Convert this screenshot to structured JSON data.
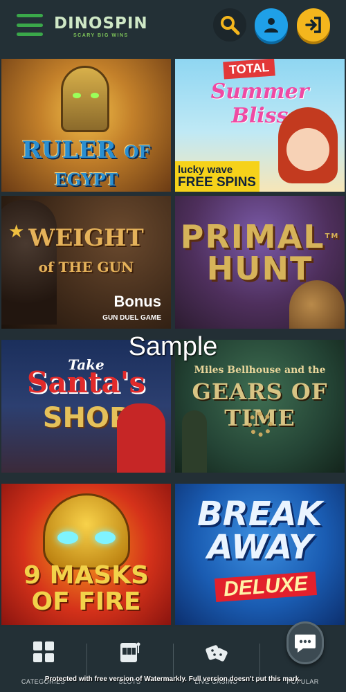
{
  "header": {
    "brand": "DINOSPIN",
    "tagline": "SCARY BIG WINS",
    "icons": [
      "menu-icon",
      "search-icon",
      "user-icon",
      "login-icon"
    ],
    "colors": {
      "accent_green": "#3aa84a",
      "user_blue": "#1fa0e8",
      "login_yellow": "#f4b61d"
    }
  },
  "games": [
    {
      "title_line1": "RULER",
      "title_line2": "OF EGYPT"
    },
    {
      "badge": "TOTAL",
      "title_line1": "Summer",
      "title_line2": "Bliss",
      "promo_line1": "lucky wave",
      "promo_line2": "FREE SPINS"
    },
    {
      "title_line1": "WEIGHT",
      "title_line2": "of THE GUN",
      "bonus": "Bonus",
      "bonus_sub": "GUN DUEL GAME"
    },
    {
      "title_line1": "PRIMAL",
      "title_line2": "HUNT",
      "tm": "TM"
    },
    {
      "title_line0": "Take",
      "title_line1": "Santa's",
      "title_line2": "SHOP"
    },
    {
      "subtitle": "Miles Bellhouse and the",
      "title_line1": "GEARS OF TIME"
    },
    {
      "title_line1": "9 MASKS",
      "title_line2": "OF FIRE"
    },
    {
      "title_line1": "BREAK",
      "title_line2": "AWAY",
      "badge": "DELUXE"
    }
  ],
  "watermark": "Sample",
  "bottom_nav": {
    "items": [
      {
        "label": "CATEGORIES",
        "icon": "grid-icon"
      },
      {
        "label": "SLOTS",
        "icon": "slot-machine-icon"
      },
      {
        "label": "LIVE CASINO",
        "icon": "dice-icon"
      },
      {
        "label": "POPULAR",
        "icon": "star-icon"
      }
    ],
    "chat_icon": "chat-icon"
  },
  "protected_text": "Protected with free version of Watermarkly. Full version doesn't put this mark."
}
